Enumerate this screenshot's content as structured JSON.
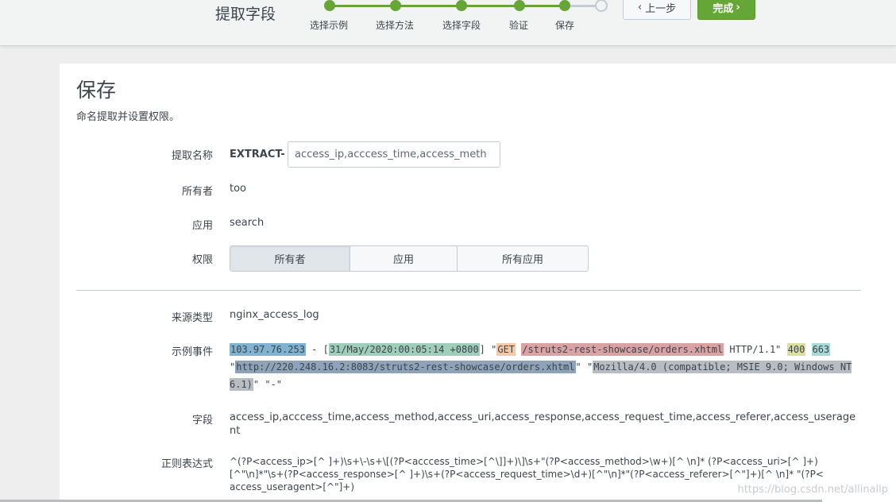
{
  "header": {
    "title": "提取字段",
    "steps": [
      "选择示例",
      "选择方法",
      "选择字段",
      "验证",
      "保存"
    ],
    "prev_label": "上一步",
    "done_label": "完成",
    "accent_color": "#65a637"
  },
  "section": {
    "title": "保存",
    "subtitle": "命名提取并设置权限。"
  },
  "form": {
    "name_label": "提取名称",
    "name_prefix": "EXTRACT-",
    "name_value": "access_ip,acccess_time,access_meth",
    "owner_label": "所有者",
    "owner_value": "too",
    "app_label": "应用",
    "app_value": "search",
    "perm_label": "权限",
    "perm_options": [
      "所有者",
      "应用",
      "所有应用"
    ],
    "perm_selected": "所有者",
    "sourcetype_label": "来源类型",
    "sourcetype_value": "nginx_access_log",
    "sample_label": "示例事件",
    "sample": {
      "ip": "103.97.76.253",
      "sep1": " - [",
      "time": "31/May/2020:00:05:14 +0800",
      "sep2": "] \"",
      "method": "GET",
      "sep3": " ",
      "uri": "/struts2-rest-showcase/orders.xhtml",
      "sep4": " HTTP/1.1\" ",
      "response": "400",
      "sep5": " ",
      "request_time": "663",
      "sep6": " \"",
      "referer": "http://220.248.16.2:8083/struts2-rest-showcase/orders.xhtml",
      "sep7": "\" \"",
      "useragent": "Mozilla/4.0 (compatible; MSIE 9.0; Windows NT 6.1)",
      "sep8": "\" \"-\""
    },
    "fields_label": "字段",
    "fields_value": "access_ip,acccess_time,access_method,access_uri,access_response,access_request_time,access_referer,access_useragent",
    "regex_label": "正则表达式",
    "regex_value": "^(?P<access_ip>[^ ]+)\\s+\\-\\s+\\[(?P<acccess_time>[^\\]]+)\\]\\s+\"(?P<access_method>\\w+)[^ \\n]* (?P<access_uri>[^ ]+)[^\"\\n]*\"\\s+(?P<access_response>[^ ]+)\\s+(?P<access_request_time>\\d+)[^\"\\n]*\"(?P<access_referer>[^\"]+)[^ \\n]* \"(?P<access_useragent>[^\"]+)"
  },
  "highlight_colors": {
    "ip": "#7fb3cf",
    "time": "#9fcfba",
    "method": "#f5c9a6",
    "uri": "#d9a3a3",
    "response": "#d9e0a0",
    "request_time": "#a9d8d5",
    "referer": "#8fa3b8",
    "useragent": "#b8bdc3"
  },
  "watermark": "https://blog.csdn.net/allinallp"
}
